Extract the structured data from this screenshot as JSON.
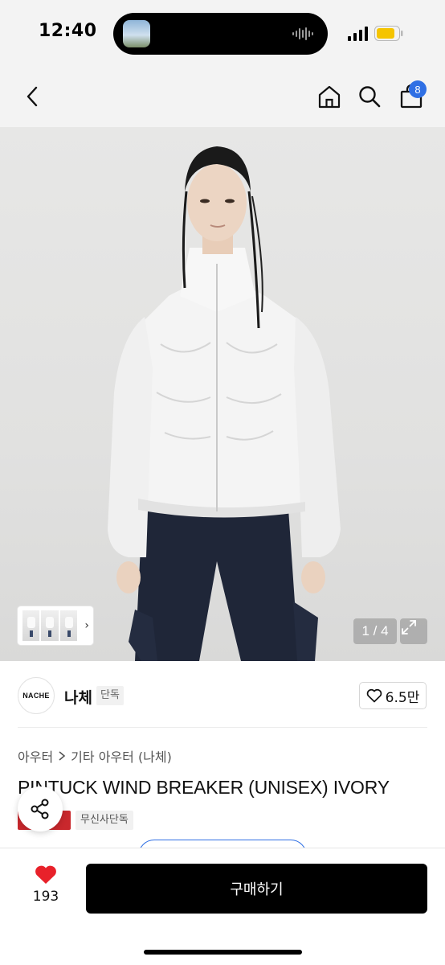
{
  "status_bar": {
    "time": "12:40",
    "battery_color": "#f5c400"
  },
  "nav": {
    "cart_count": "8",
    "icons": [
      "back-chevron-icon",
      "home-icon",
      "search-icon",
      "shopping-bag-icon"
    ]
  },
  "gallery": {
    "counter": "1 / 4"
  },
  "brand": {
    "logo_text": "NACHE",
    "name": "나체",
    "tag": "단독",
    "likes": "6.5만"
  },
  "product": {
    "breadcrumb": [
      "아우터",
      "기타 아우터 (나체)"
    ],
    "title": "PINTUCK WIND BREAKER (UNISEX) IVORY",
    "badges": [
      "무신사단독"
    ]
  },
  "bottom_bar": {
    "wish_count": "193",
    "buy_label": "구매하기"
  },
  "colors": {
    "accent_blue": "#2f6fe4",
    "heart_red": "#e8212a",
    "badge_red": "#c9282d"
  }
}
